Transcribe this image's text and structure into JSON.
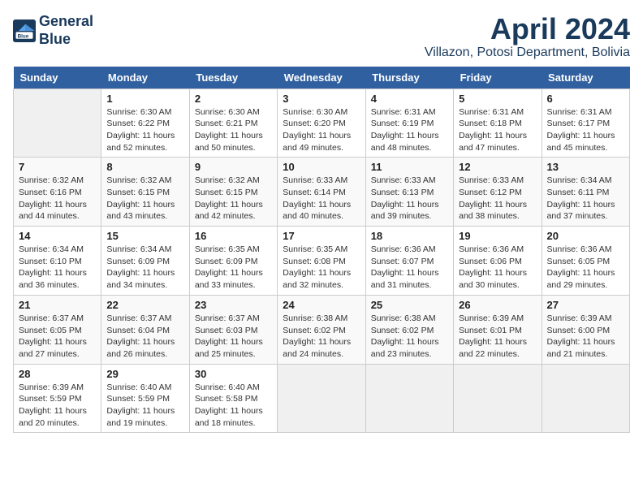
{
  "header": {
    "logo_line1": "General",
    "logo_line2": "Blue",
    "month_title": "April 2024",
    "location": "Villazon, Potosi Department, Bolivia"
  },
  "weekdays": [
    "Sunday",
    "Monday",
    "Tuesday",
    "Wednesday",
    "Thursday",
    "Friday",
    "Saturday"
  ],
  "weeks": [
    [
      {
        "day": "",
        "info": ""
      },
      {
        "day": "1",
        "info": "Sunrise: 6:30 AM\nSunset: 6:22 PM\nDaylight: 11 hours\nand 52 minutes."
      },
      {
        "day": "2",
        "info": "Sunrise: 6:30 AM\nSunset: 6:21 PM\nDaylight: 11 hours\nand 50 minutes."
      },
      {
        "day": "3",
        "info": "Sunrise: 6:30 AM\nSunset: 6:20 PM\nDaylight: 11 hours\nand 49 minutes."
      },
      {
        "day": "4",
        "info": "Sunrise: 6:31 AM\nSunset: 6:19 PM\nDaylight: 11 hours\nand 48 minutes."
      },
      {
        "day": "5",
        "info": "Sunrise: 6:31 AM\nSunset: 6:18 PM\nDaylight: 11 hours\nand 47 minutes."
      },
      {
        "day": "6",
        "info": "Sunrise: 6:31 AM\nSunset: 6:17 PM\nDaylight: 11 hours\nand 45 minutes."
      }
    ],
    [
      {
        "day": "7",
        "info": "Sunrise: 6:32 AM\nSunset: 6:16 PM\nDaylight: 11 hours\nand 44 minutes."
      },
      {
        "day": "8",
        "info": "Sunrise: 6:32 AM\nSunset: 6:15 PM\nDaylight: 11 hours\nand 43 minutes."
      },
      {
        "day": "9",
        "info": "Sunrise: 6:32 AM\nSunset: 6:15 PM\nDaylight: 11 hours\nand 42 minutes."
      },
      {
        "day": "10",
        "info": "Sunrise: 6:33 AM\nSunset: 6:14 PM\nDaylight: 11 hours\nand 40 minutes."
      },
      {
        "day": "11",
        "info": "Sunrise: 6:33 AM\nSunset: 6:13 PM\nDaylight: 11 hours\nand 39 minutes."
      },
      {
        "day": "12",
        "info": "Sunrise: 6:33 AM\nSunset: 6:12 PM\nDaylight: 11 hours\nand 38 minutes."
      },
      {
        "day": "13",
        "info": "Sunrise: 6:34 AM\nSunset: 6:11 PM\nDaylight: 11 hours\nand 37 minutes."
      }
    ],
    [
      {
        "day": "14",
        "info": "Sunrise: 6:34 AM\nSunset: 6:10 PM\nDaylight: 11 hours\nand 36 minutes."
      },
      {
        "day": "15",
        "info": "Sunrise: 6:34 AM\nSunset: 6:09 PM\nDaylight: 11 hours\nand 34 minutes."
      },
      {
        "day": "16",
        "info": "Sunrise: 6:35 AM\nSunset: 6:09 PM\nDaylight: 11 hours\nand 33 minutes."
      },
      {
        "day": "17",
        "info": "Sunrise: 6:35 AM\nSunset: 6:08 PM\nDaylight: 11 hours\nand 32 minutes."
      },
      {
        "day": "18",
        "info": "Sunrise: 6:36 AM\nSunset: 6:07 PM\nDaylight: 11 hours\nand 31 minutes."
      },
      {
        "day": "19",
        "info": "Sunrise: 6:36 AM\nSunset: 6:06 PM\nDaylight: 11 hours\nand 30 minutes."
      },
      {
        "day": "20",
        "info": "Sunrise: 6:36 AM\nSunset: 6:05 PM\nDaylight: 11 hours\nand 29 minutes."
      }
    ],
    [
      {
        "day": "21",
        "info": "Sunrise: 6:37 AM\nSunset: 6:05 PM\nDaylight: 11 hours\nand 27 minutes."
      },
      {
        "day": "22",
        "info": "Sunrise: 6:37 AM\nSunset: 6:04 PM\nDaylight: 11 hours\nand 26 minutes."
      },
      {
        "day": "23",
        "info": "Sunrise: 6:37 AM\nSunset: 6:03 PM\nDaylight: 11 hours\nand 25 minutes."
      },
      {
        "day": "24",
        "info": "Sunrise: 6:38 AM\nSunset: 6:02 PM\nDaylight: 11 hours\nand 24 minutes."
      },
      {
        "day": "25",
        "info": "Sunrise: 6:38 AM\nSunset: 6:02 PM\nDaylight: 11 hours\nand 23 minutes."
      },
      {
        "day": "26",
        "info": "Sunrise: 6:39 AM\nSunset: 6:01 PM\nDaylight: 11 hours\nand 22 minutes."
      },
      {
        "day": "27",
        "info": "Sunrise: 6:39 AM\nSunset: 6:00 PM\nDaylight: 11 hours\nand 21 minutes."
      }
    ],
    [
      {
        "day": "28",
        "info": "Sunrise: 6:39 AM\nSunset: 5:59 PM\nDaylight: 11 hours\nand 20 minutes."
      },
      {
        "day": "29",
        "info": "Sunrise: 6:40 AM\nSunset: 5:59 PM\nDaylight: 11 hours\nand 19 minutes."
      },
      {
        "day": "30",
        "info": "Sunrise: 6:40 AM\nSunset: 5:58 PM\nDaylight: 11 hours\nand 18 minutes."
      },
      {
        "day": "",
        "info": ""
      },
      {
        "day": "",
        "info": ""
      },
      {
        "day": "",
        "info": ""
      },
      {
        "day": "",
        "info": ""
      }
    ]
  ]
}
